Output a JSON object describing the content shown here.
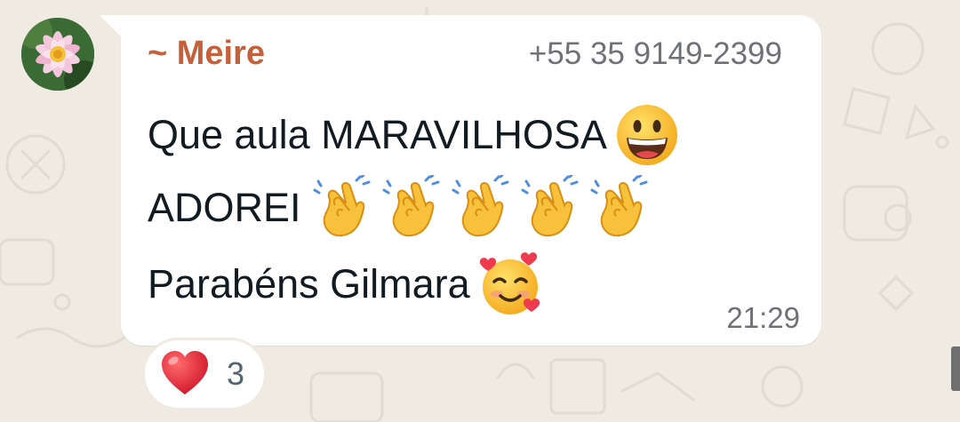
{
  "message": {
    "sender_name": "~ Meire",
    "sender_phone": "+55 35 9149-2399",
    "lines": [
      {
        "text": "Que aula MARAVILHOSA",
        "emojis": [
          "grinning-face"
        ]
      },
      {
        "text": "ADOREI",
        "emojis": [
          "clapping-hands",
          "clapping-hands",
          "clapping-hands",
          "clapping-hands",
          "clapping-hands"
        ]
      },
      {
        "text": "Parabéns Gilmara",
        "emojis": [
          "smiling-face-with-hearts"
        ]
      }
    ],
    "time": "21:29"
  },
  "reaction": {
    "emoji": "red-heart",
    "count": "3"
  },
  "colors": {
    "background": "#efeae2",
    "bubble": "#ffffff",
    "sender_name": "#c5603b",
    "meta_text": "#6e7175",
    "message_text": "#111b21"
  }
}
